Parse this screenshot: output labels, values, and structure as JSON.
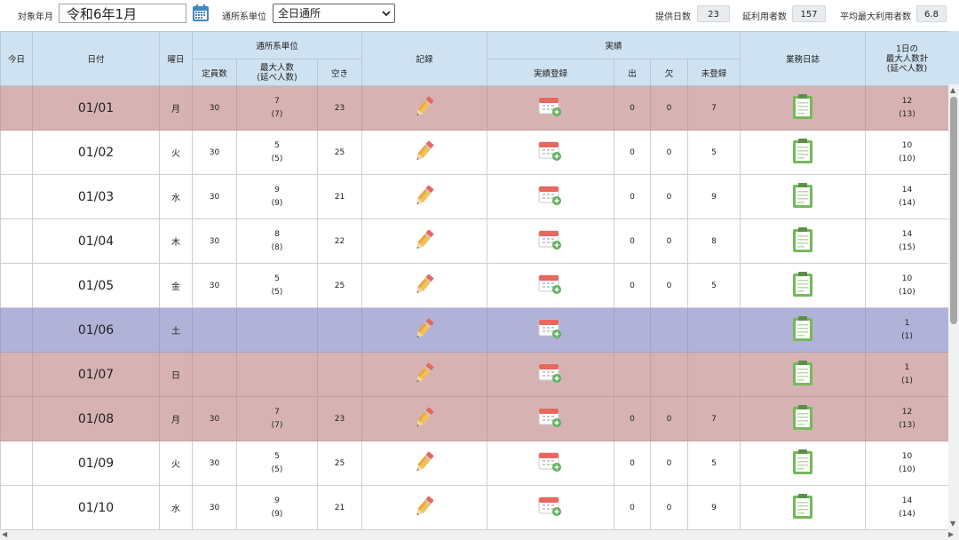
{
  "filters": {
    "month_label": "対象年月",
    "month_value": "令和6年1月",
    "unit_label": "通所系単位",
    "unit_value": "全日通所"
  },
  "stats": {
    "provided_days_label": "提供日数",
    "provided_days": "23",
    "total_users_label": "延利用者数",
    "total_users": "157",
    "avg_max_label": "平均最大利用者数",
    "avg_max": "6.8"
  },
  "headers": {
    "today": "今日",
    "date": "日付",
    "dow": "曜日",
    "unit_group": "通所系単位",
    "capacity": "定員数",
    "max_people_1": "最大人数",
    "max_people_2": "(延べ人数)",
    "vacancy": "空き",
    "record": "記録",
    "results_group": "実績",
    "results_reg": "実績登録",
    "present": "出",
    "absent": "欠",
    "unregistered": "未登録",
    "daily_log": "業務日誌",
    "max_total_1": "1日の",
    "max_total_2": "最大人数計",
    "max_total_3": "(延べ人数)"
  },
  "icons": {
    "calendar": "calendar-icon",
    "record": "pencil-icon",
    "results": "calendar-add-icon",
    "log": "clipboard-icon",
    "dropdown": "chevron-down-icon"
  },
  "colors": {
    "holiday_row": "#d7b2b2",
    "saturday_row": "#b1b2d8",
    "header_bg": "#cfe2f1"
  },
  "rows": [
    {
      "date": "01/01",
      "dow": "月",
      "type": "holiday",
      "capacity": "30",
      "max": "7",
      "max_total": "(7)",
      "vacancy": "23",
      "present": "0",
      "absent": "0",
      "unregistered": "7",
      "day_max": "12",
      "day_max_total": "(13)"
    },
    {
      "date": "01/02",
      "dow": "火",
      "type": "weekday",
      "capacity": "30",
      "max": "5",
      "max_total": "(5)",
      "vacancy": "25",
      "present": "0",
      "absent": "0",
      "unregistered": "5",
      "day_max": "10",
      "day_max_total": "(10)"
    },
    {
      "date": "01/03",
      "dow": "水",
      "type": "weekday",
      "capacity": "30",
      "max": "9",
      "max_total": "(9)",
      "vacancy": "21",
      "present": "0",
      "absent": "0",
      "unregistered": "9",
      "day_max": "14",
      "day_max_total": "(14)"
    },
    {
      "date": "01/04",
      "dow": "木",
      "type": "weekday",
      "capacity": "30",
      "max": "8",
      "max_total": "(8)",
      "vacancy": "22",
      "present": "0",
      "absent": "0",
      "unregistered": "8",
      "day_max": "14",
      "day_max_total": "(15)"
    },
    {
      "date": "01/05",
      "dow": "金",
      "type": "weekday",
      "capacity": "30",
      "max": "5",
      "max_total": "(5)",
      "vacancy": "25",
      "present": "0",
      "absent": "0",
      "unregistered": "5",
      "day_max": "10",
      "day_max_total": "(10)"
    },
    {
      "date": "01/06",
      "dow": "土",
      "type": "saturday",
      "capacity": "",
      "max": "",
      "max_total": "",
      "vacancy": "",
      "present": "",
      "absent": "",
      "unregistered": "",
      "day_max": "1",
      "day_max_total": "(1)"
    },
    {
      "date": "01/07",
      "dow": "日",
      "type": "holiday",
      "capacity": "",
      "max": "",
      "max_total": "",
      "vacancy": "",
      "present": "",
      "absent": "",
      "unregistered": "",
      "day_max": "1",
      "day_max_total": "(1)"
    },
    {
      "date": "01/08",
      "dow": "月",
      "type": "holiday",
      "capacity": "30",
      "max": "7",
      "max_total": "(7)",
      "vacancy": "23",
      "present": "0",
      "absent": "0",
      "unregistered": "7",
      "day_max": "12",
      "day_max_total": "(13)"
    },
    {
      "date": "01/09",
      "dow": "火",
      "type": "weekday",
      "capacity": "30",
      "max": "5",
      "max_total": "(5)",
      "vacancy": "25",
      "present": "0",
      "absent": "0",
      "unregistered": "5",
      "day_max": "10",
      "day_max_total": "(10)"
    },
    {
      "date": "01/10",
      "dow": "水",
      "type": "weekday",
      "capacity": "30",
      "max": "9",
      "max_total": "(9)",
      "vacancy": "21",
      "present": "0",
      "absent": "0",
      "unregistered": "9",
      "day_max": "14",
      "day_max_total": "(14)"
    }
  ]
}
